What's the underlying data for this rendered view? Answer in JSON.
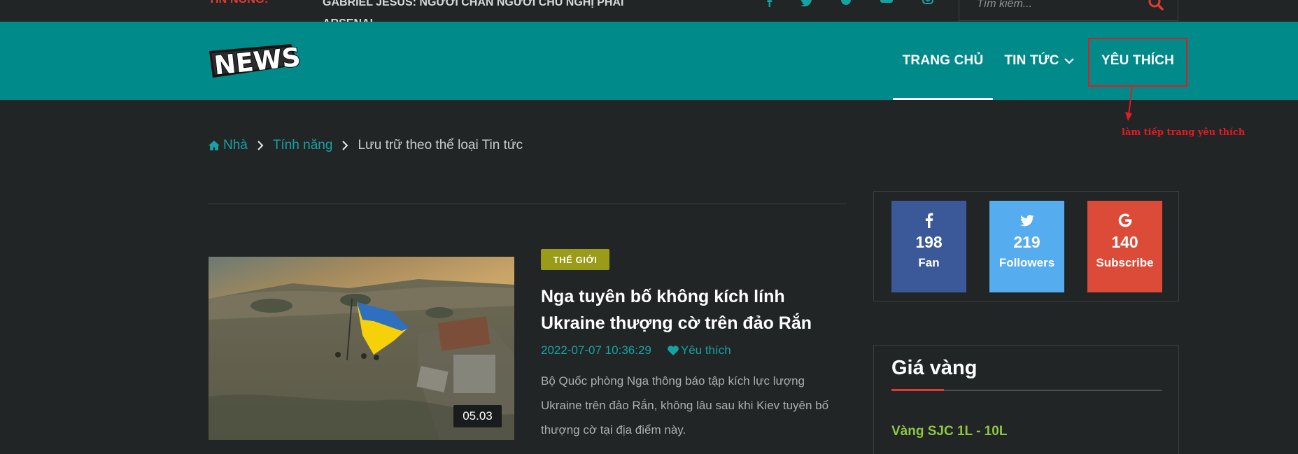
{
  "topbar": {
    "hot_label": "TIN NÓNG:",
    "ticker_text": "GABRIEL JESUS: NGƯỜI CHÁN NGƯỜI CHÚ NGHỊ PHẢI ARSENAL",
    "search_placeholder": "Tìm kiếm...",
    "social_icons": [
      "facebook-icon",
      "twitter-icon",
      "pinterest-icon",
      "youtube-icon",
      "instagram-icon"
    ]
  },
  "header": {
    "logo_text": "NEWS",
    "nav": {
      "home": "TRANG CHỦ",
      "news": "TIN TỨC",
      "favorites": "YÊU THÍCH"
    },
    "annotation": "làm tiếp trang yêu thích"
  },
  "breadcrumb": {
    "home": "Nhà",
    "features": "Tính năng",
    "current": "Lưu trữ theo thể loại Tin tức"
  },
  "article": {
    "category": "THẾ GIỚI",
    "title": "Nga tuyên bố không kích lính Ukraine thượng cờ trên đảo Rắn",
    "date": "2022-07-07 10:36:29",
    "favorite_label": "Yêu thích",
    "excerpt": "Bộ Quốc phòng Nga thông báo tập kích lực lượng Ukraine trên đảo Rắn, không lâu sau khi Kiev tuyên bố thượng cờ tại địa điểm này.",
    "video_duration": "05.03"
  },
  "sidebar": {
    "social": [
      {
        "icon": "facebook-icon",
        "count": "198",
        "label": "Fan",
        "color": "#3b5998"
      },
      {
        "icon": "twitter-icon",
        "count": "219",
        "label": "Followers",
        "color": "#55acee"
      },
      {
        "icon": "google-icon",
        "count": "140",
        "label": "Subscribe",
        "color": "#dc4a38"
      }
    ],
    "gold": {
      "title": "Giá vàng",
      "first_item": "Vàng SJC 1L - 10L"
    }
  },
  "colors": {
    "header_bg": "#008a8a",
    "accent_teal": "#17a2a2",
    "page_bg": "#222526",
    "hot_red": "#e03c31",
    "category_badge": "#9a9b18",
    "gold_item_green": "#8ec641"
  }
}
